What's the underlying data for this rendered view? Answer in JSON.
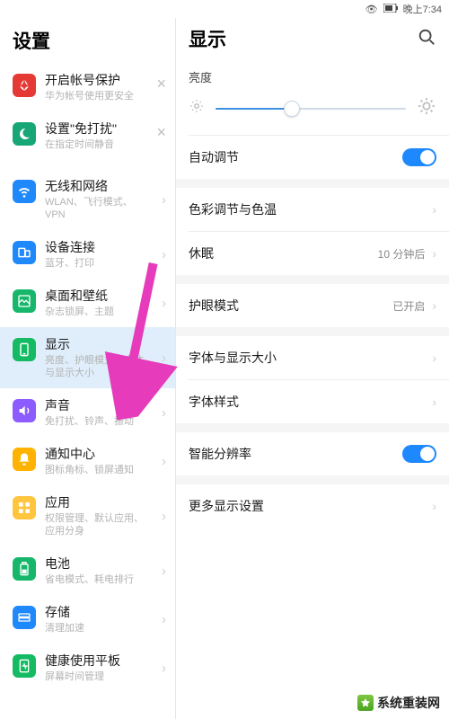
{
  "status": {
    "eye": "👁",
    "battery": "▥",
    "time_label": "晚上7:34"
  },
  "left": {
    "title": "设置",
    "promo": [
      {
        "label": "开启帐号保护",
        "sub": "华为帐号使用更安全"
      },
      {
        "label": "设置\"免打扰\"",
        "sub": "在指定时间静音"
      }
    ],
    "items": [
      {
        "label": "无线和网络",
        "sub": "WLAN、飞行模式、VPN"
      },
      {
        "label": "设备连接",
        "sub": "蓝牙、打印"
      },
      {
        "label": "桌面和壁纸",
        "sub": "杂志锁屏、主题"
      },
      {
        "label": "显示",
        "sub": "亮度、护眼模式、字体与显示大小"
      },
      {
        "label": "声音",
        "sub": "免打扰、铃声、振动"
      },
      {
        "label": "通知中心",
        "sub": "图标角标、锁屏通知"
      },
      {
        "label": "应用",
        "sub": "权限管理、默认应用、应用分身"
      },
      {
        "label": "电池",
        "sub": "省电模式、耗电排行"
      },
      {
        "label": "存储",
        "sub": "清理加速"
      },
      {
        "label": "健康使用平板",
        "sub": "屏幕时间管理"
      }
    ]
  },
  "right": {
    "title": "显示",
    "sections": {
      "brightness_label": "亮度",
      "auto_adjust": "自动调节",
      "color_temp": "色彩调节与色温",
      "sleep": {
        "label": "休眠",
        "value": "10 分钟后"
      },
      "eye_mode": {
        "label": "护眼模式",
        "value": "已开启"
      },
      "font_size": "字体与显示大小",
      "font_style": "字体样式",
      "smart_res": "智能分辨率",
      "more": "更多显示设置"
    }
  },
  "watermark": "系统重装网",
  "colors": {
    "accent": "#1e88ff",
    "arrow": "#e63cbb"
  }
}
